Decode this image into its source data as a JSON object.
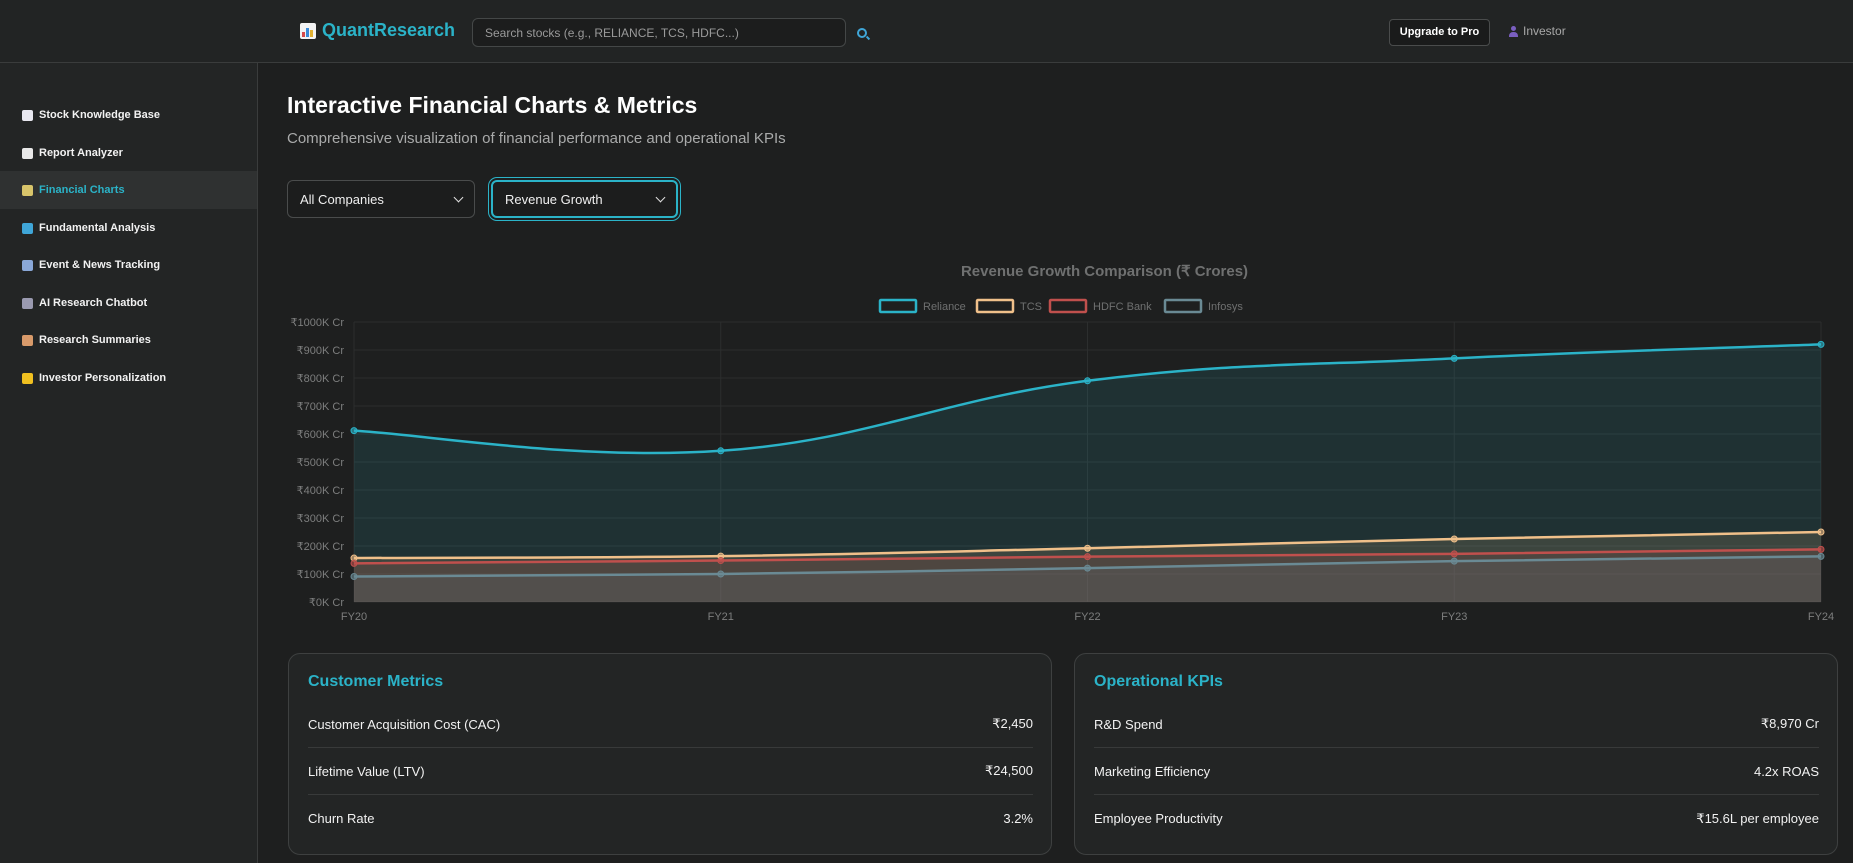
{
  "header": {
    "brand": "QuantResearch",
    "search_placeholder": "Search stocks (e.g., RELIANCE, TCS, HDFC...)",
    "upgrade_label": "Upgrade to Pro",
    "user_label": "Investor"
  },
  "sidebar": {
    "items": [
      {
        "label": "Stock Knowledge Base",
        "icon": "chart-up-icon",
        "color": "#e8e8f0"
      },
      {
        "label": "Report Analyzer",
        "icon": "document-icon",
        "color": "#e8e8e8"
      },
      {
        "label": "Financial Charts",
        "icon": "bar-chart-icon",
        "color": "#d8c46a"
      },
      {
        "label": "Fundamental Analysis",
        "icon": "magnifier-icon",
        "color": "#3fa6d8"
      },
      {
        "label": "Event & News Tracking",
        "icon": "calendar-icon",
        "color": "#8aa8d8"
      },
      {
        "label": "AI Research Chatbot",
        "icon": "robot-icon",
        "color": "#9a9ab0"
      },
      {
        "label": "Research Summaries",
        "icon": "clipboard-icon",
        "color": "#d89a6a"
      },
      {
        "label": "Investor Personalization",
        "icon": "star-icon",
        "color": "#f0c020"
      }
    ],
    "active_index": 2
  },
  "main": {
    "title": "Interactive Financial Charts & Metrics",
    "subtitle": "Comprehensive visualization of financial performance and operational KPIs",
    "company_select": "All Companies",
    "metric_select": "Revenue Growth"
  },
  "chart_data": {
    "type": "area",
    "title": "Revenue Growth Comparison (₹ Crores)",
    "categories": [
      "FY20",
      "FY21",
      "FY22",
      "FY23",
      "FY24"
    ],
    "y_tick_labels": [
      "₹0K Cr",
      "₹100K Cr",
      "₹200K Cr",
      "₹300K Cr",
      "₹400K Cr",
      "₹500K Cr",
      "₹600K Cr",
      "₹700K Cr",
      "₹800K Cr",
      "₹900K Cr",
      "₹1000K Cr"
    ],
    "ylim": [
      0,
      1000000
    ],
    "legend_position": "top",
    "grid": true,
    "series": [
      {
        "name": "Reliance",
        "values": [
          612000,
          540000,
          790000,
          870000,
          920000
        ],
        "color": "#2bb3c8"
      },
      {
        "name": "TCS",
        "values": [
          157000,
          164000,
          192000,
          225000,
          250000
        ],
        "color": "#f0c08a"
      },
      {
        "name": "HDFC Bank",
        "values": [
          138000,
          148000,
          162000,
          172000,
          188000
        ],
        "color": "#c0504d"
      },
      {
        "name": "Infosys",
        "values": [
          91000,
          100000,
          121000,
          146000,
          163000
        ],
        "color": "#6a8a94"
      }
    ]
  },
  "customer_metrics": {
    "title": "Customer Metrics",
    "rows": [
      {
        "label": "Customer Acquisition Cost (CAC)",
        "value": "₹2,450"
      },
      {
        "label": "Lifetime Value (LTV)",
        "value": "₹24,500"
      },
      {
        "label": "Churn Rate",
        "value": "3.2%"
      }
    ]
  },
  "operational_kpis": {
    "title": "Operational KPIs",
    "rows": [
      {
        "label": "R&D Spend",
        "value": "₹8,970 Cr"
      },
      {
        "label": "Marketing Efficiency",
        "value": "4.2x ROAS"
      },
      {
        "label": "Employee Productivity",
        "value": "₹15.6L per employee"
      }
    ]
  }
}
